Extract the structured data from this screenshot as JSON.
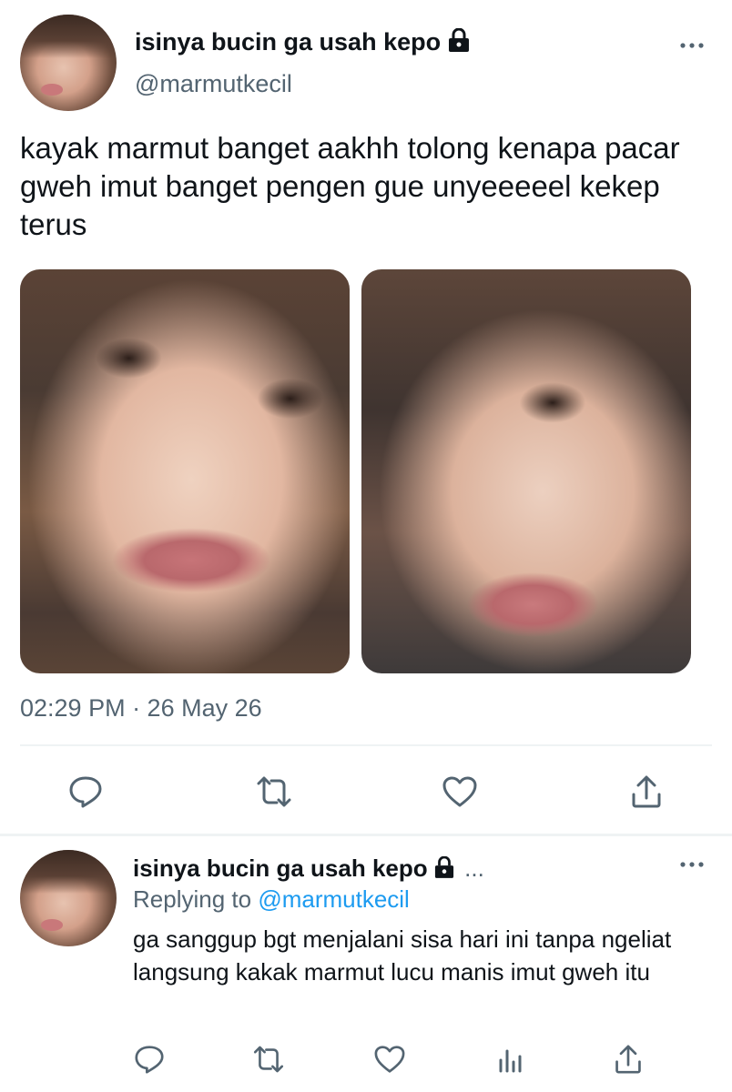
{
  "tweet": {
    "display_name": "isinya bucin ga usah kepo",
    "handle": "@marmutkecil",
    "text": "kayak marmut banget aakhh tolong kenapa pacar gweh imut banget pengen gue unyeeeeel kekep terus",
    "timestamp": "02:29 PM · 26 May 26",
    "icons": {
      "lock": "lock-icon",
      "more": "more-icon"
    },
    "actions": [
      {
        "name": "reply-icon"
      },
      {
        "name": "retweet-icon"
      },
      {
        "name": "like-icon"
      },
      {
        "name": "share-icon"
      }
    ]
  },
  "reply": {
    "display_name": "isinya bucin ga usah kepo",
    "ellipsis": "...",
    "replying_prefix": "Replying to",
    "replying_handle": "@marmutkecil",
    "text": "ga sanggup bgt menjalani sisa hari ini tanpa ngeliat langsung kakak marmut lucu manis imut gweh itu",
    "actions": [
      {
        "name": "reply-icon"
      },
      {
        "name": "retweet-icon"
      },
      {
        "name": "like-icon"
      },
      {
        "name": "analytics-icon"
      },
      {
        "name": "share-icon"
      }
    ]
  },
  "colors": {
    "text": "#0f1419",
    "secondary": "#536471",
    "link": "#1d9bf0",
    "divider": "#eff3f4"
  }
}
